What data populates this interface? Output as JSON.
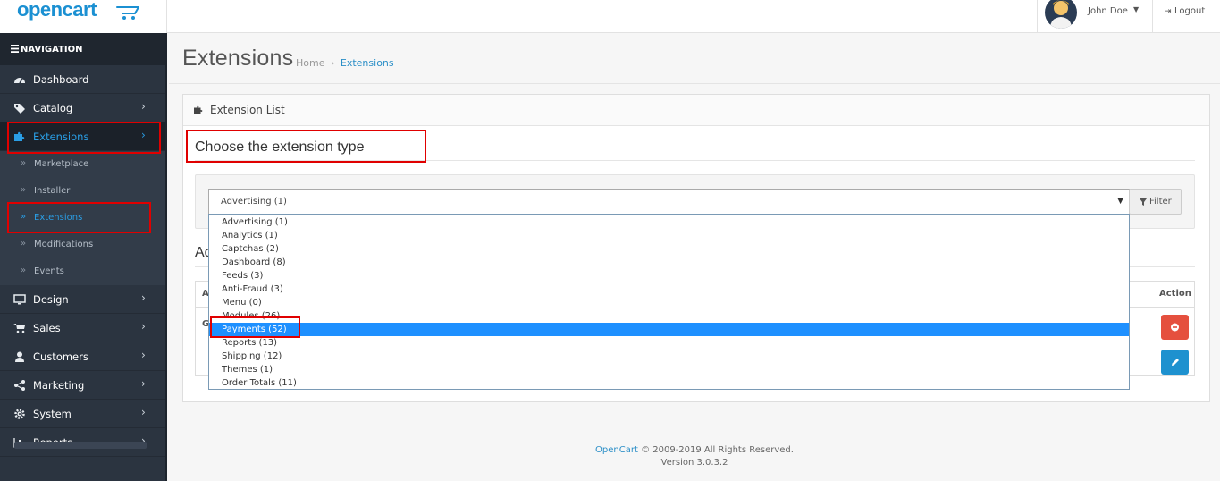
{
  "header": {
    "logo_text": "opencart",
    "user_name": "John Doe",
    "logout_label": "Logout"
  },
  "sidebar": {
    "nav_title": "NAVIGATION",
    "items": [
      {
        "label": "Dashboard",
        "icon": "dashboard-icon"
      },
      {
        "label": "Catalog",
        "icon": "tags-icon"
      },
      {
        "label": "Extensions",
        "icon": "puzzle-icon",
        "active": true
      },
      {
        "label": "Design",
        "icon": "monitor-icon"
      },
      {
        "label": "Sales",
        "icon": "cart-icon"
      },
      {
        "label": "Customers",
        "icon": "user-icon"
      },
      {
        "label": "Marketing",
        "icon": "share-icon"
      },
      {
        "label": "System",
        "icon": "gear-icon"
      },
      {
        "label": "Reports",
        "icon": "bar-chart-icon"
      }
    ],
    "extensions_sub": [
      {
        "label": "Marketplace"
      },
      {
        "label": "Installer"
      },
      {
        "label": "Extensions",
        "active": true
      },
      {
        "label": "Modifications"
      },
      {
        "label": "Events"
      }
    ]
  },
  "page": {
    "title": "Extensions",
    "breadcrumb_home": "Home",
    "breadcrumb_sep": "›",
    "breadcrumb_current": "Extensions"
  },
  "panel": {
    "heading": "Extension List",
    "choose_title": "Choose the extension type",
    "select_value": "Advertising (1)",
    "filter_label": "Filter",
    "sub_heading_partial": "Ad",
    "table_header_first_partial": "Ad",
    "table_header_action": "Action",
    "table_row_first_partial": "Go"
  },
  "dropdown": {
    "options": [
      "Advertising (1)",
      "Analytics (1)",
      "Captchas (2)",
      "Dashboard (8)",
      "Feeds (3)",
      "Anti-Fraud (3)",
      "Menu (0)",
      "Modules (26)",
      "Payments (52)",
      "Reports (13)",
      "Shipping (12)",
      "Themes (1)",
      "Order Totals (11)"
    ],
    "highlighted": "Payments (52)"
  },
  "footer": {
    "brand": "OpenCart",
    "copyright": " © 2009-2019 All Rights Reserved.",
    "version": "Version 3.0.3.2"
  },
  "colors": {
    "brand_blue": "#1b90d2",
    "sidebar_bg": "#2b3440",
    "active_blue": "#2a9ee5",
    "highlight": "#1e90ff",
    "annotation_red": "#e00000",
    "danger": "#e5503e",
    "primary": "#1e91cf"
  }
}
